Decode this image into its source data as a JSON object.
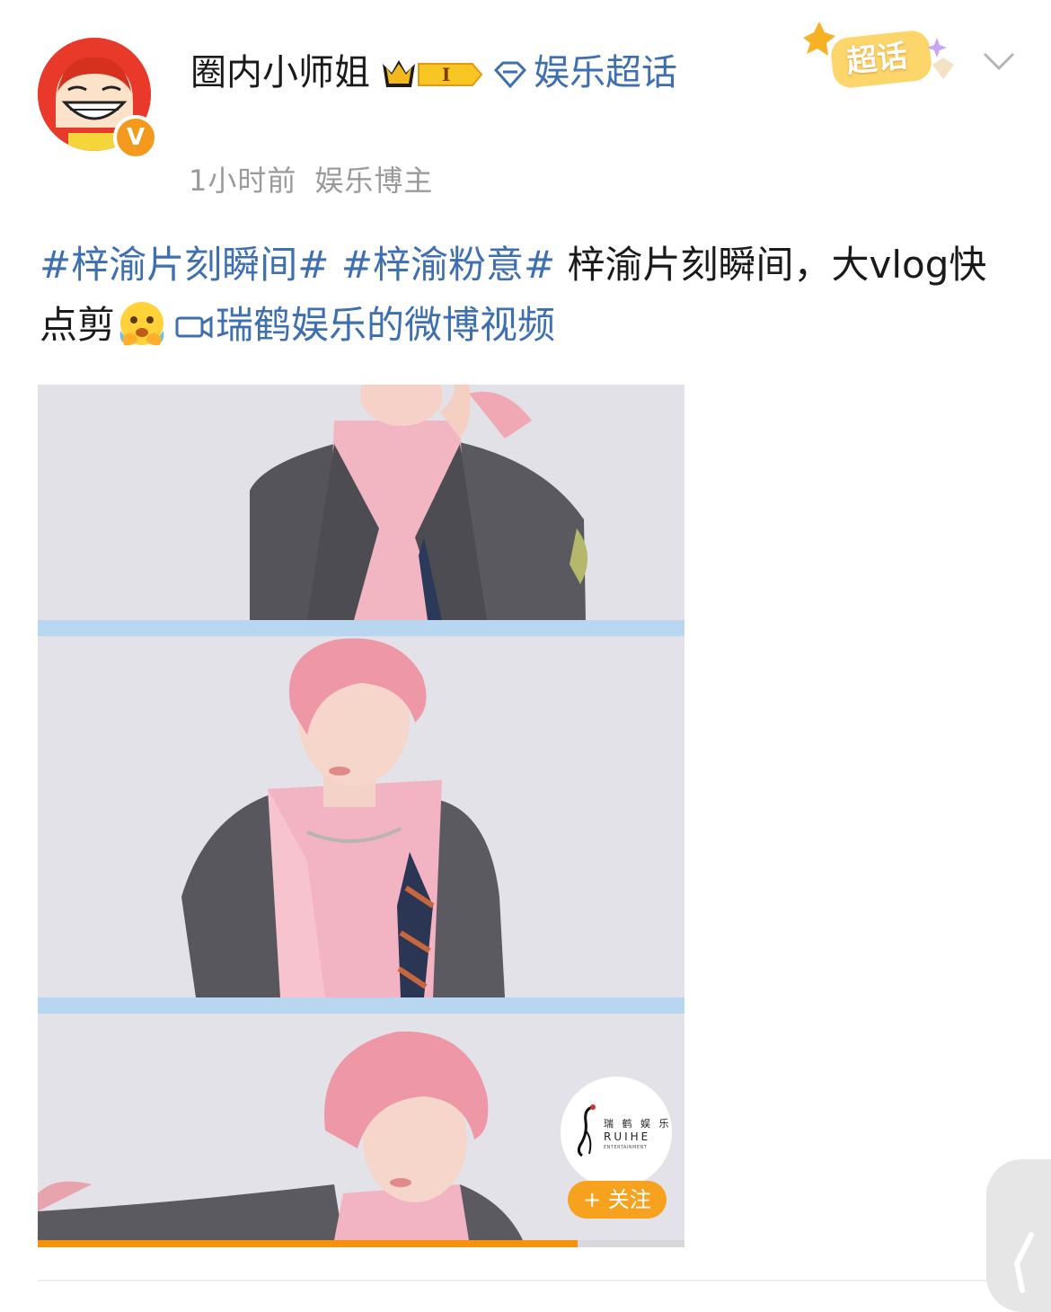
{
  "post": {
    "author": {
      "name": "圈内小师姐",
      "level_badge": "I",
      "verified_mark": "V",
      "topic_label": "娱乐超话"
    },
    "meta": {
      "time": "1小时前",
      "role": "娱乐博主"
    },
    "super_topic_badge": "超话",
    "body": {
      "hashtag1": "#梓渝片刻瞬间#",
      "hashtag2": "#梓渝粉意#",
      "text": " 梓渝片刻瞬间，大vlog快点剪",
      "video_link": "瑞鹤娱乐的微博视频"
    },
    "video": {
      "watermark_cn": "瑞 鹤 娱 乐",
      "watermark_en": "RUIHE",
      "watermark_sub": "ENTERTAINMENT",
      "follow_label": "+ 关注",
      "progress": 0.835
    }
  },
  "colors": {
    "link_blue": "#3e6fb0",
    "accent_orange": "#f7a21e",
    "progress_orange": "#f4920f",
    "divider_blue": "#b9d6f0",
    "meta_gray": "#9a9a9a"
  },
  "icons": [
    "avatar-cartoon",
    "crown-icon",
    "diamond-icon",
    "chevron-down-icon",
    "crying-emoji-icon",
    "video-camera-icon",
    "crane-logo-icon"
  ]
}
